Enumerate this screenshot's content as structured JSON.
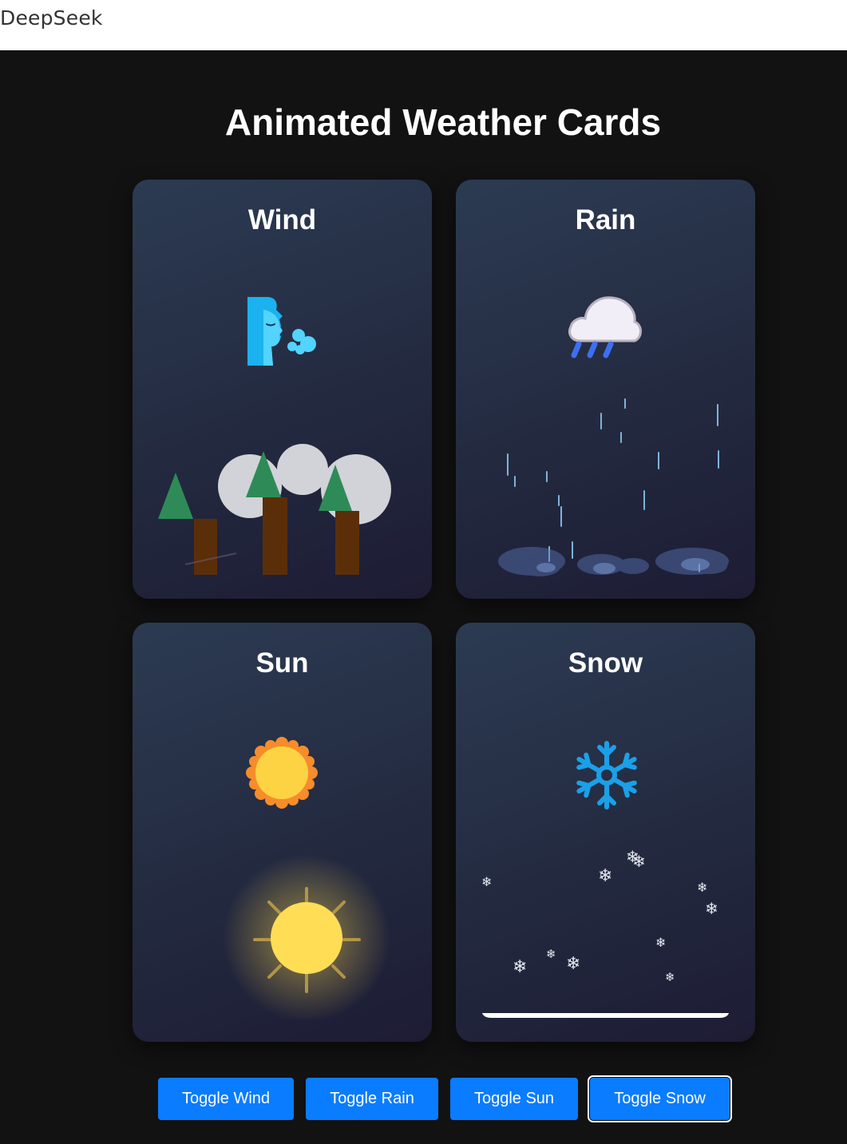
{
  "browser": {
    "title": "DeepSeek"
  },
  "page": {
    "heading": "Animated Weather Cards"
  },
  "cards": [
    {
      "title": "Wind",
      "icon": "wind-face-icon"
    },
    {
      "title": "Rain",
      "icon": "rain-cloud-icon"
    },
    {
      "title": "Sun",
      "icon": "sun-icon"
    },
    {
      "title": "Snow",
      "icon": "snowflake-icon"
    }
  ],
  "buttons": {
    "wind": "Toggle Wind",
    "rain": "Toggle Rain",
    "sun": "Toggle Sun",
    "snow": "Toggle Snow"
  },
  "colors": {
    "page_background": "#121212",
    "button": "#0a7cff",
    "tree_top": "#2e8b57",
    "trunk": "#5b2e0a",
    "sun": "#ffd84d",
    "snowflake_icon": "#1ba0e8"
  }
}
